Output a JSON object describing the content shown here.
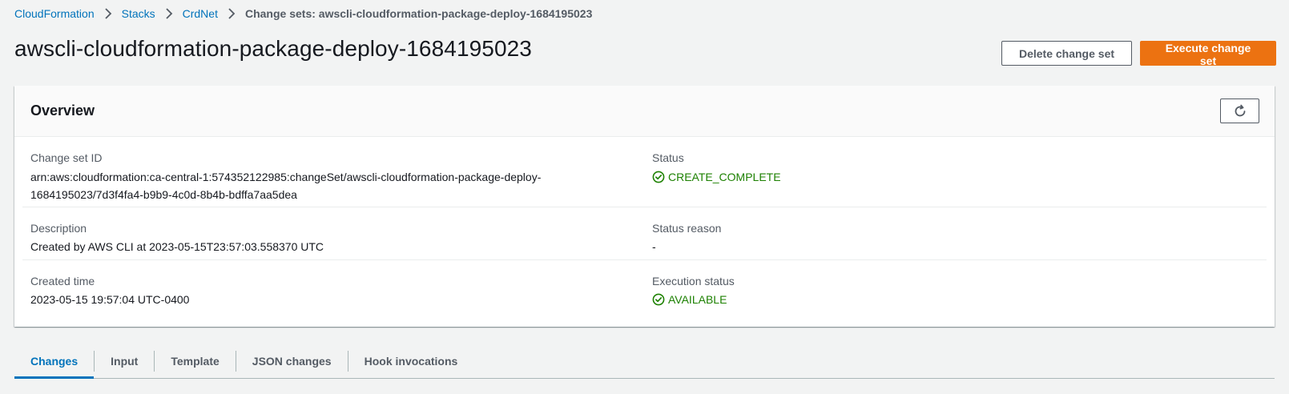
{
  "breadcrumb": {
    "items": [
      "CloudFormation",
      "Stacks",
      "CrdNet"
    ],
    "current": "Change sets: awscli-cloudformation-package-deploy-1684195023"
  },
  "page": {
    "title": "awscli-cloudformation-package-deploy-1684195023",
    "delete_label": "Delete change set",
    "execute_label": "Execute change set"
  },
  "overview": {
    "title": "Overview",
    "change_set_id_label": "Change set ID",
    "change_set_id_line1": "arn:aws:cloudformation:ca-central-1:574352122985:changeSet/awscli-cloudformation-package-deploy-",
    "change_set_id_line2": "1684195023/7d3f4fa4-b9b9-4c0d-8b4b-bdffa7aa5dea",
    "status_label": "Status",
    "status_value": "CREATE_COMPLETE",
    "description_label": "Description",
    "description_value": "Created by AWS CLI at 2023-05-15T23:57:03.558370 UTC",
    "status_reason_label": "Status reason",
    "status_reason_value": "-",
    "created_time_label": "Created time",
    "created_time_value": "2023-05-15 19:57:04 UTC-0400",
    "execution_status_label": "Execution status",
    "execution_status_value": "AVAILABLE"
  },
  "tabs": [
    "Changes",
    "Input",
    "Template",
    "JSON changes",
    "Hook invocations"
  ],
  "colors": {
    "accent": "#0073bb",
    "primary_button": "#ec7211",
    "success": "#1d8102"
  },
  "icons": [
    "chevron-right-icon",
    "refresh-icon",
    "success-check-icon"
  ]
}
